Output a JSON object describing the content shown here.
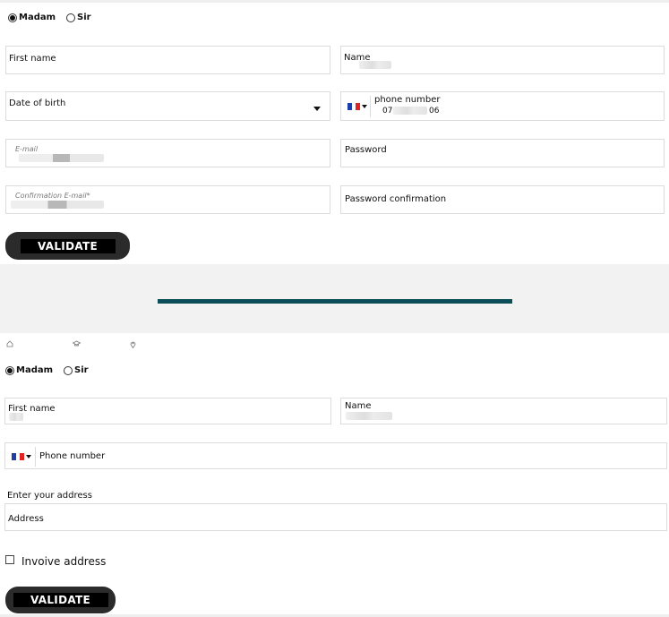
{
  "form1": {
    "gender": {
      "madam": "Madam",
      "sir": "Sir",
      "selected": "madam"
    },
    "first_name_label": "First name",
    "name_label": "Name",
    "dob_label": "Date of birth",
    "phone_label": "phone number",
    "phone_prefix": "07",
    "phone_suffix": "06",
    "email_label": "E-mail",
    "password_label": "Password",
    "confirm_email_label": "Confirmation E-mail*",
    "password_confirm_label": "Password confirmation",
    "validate_label": "VALIDATE"
  },
  "divider": {
    "color": "#0c4e57",
    "band_color": "#f2f2f2"
  },
  "steps": {
    "icons": [
      "home-icon",
      "graduation-cap-icon",
      "location-pin-icon"
    ]
  },
  "form2": {
    "gender": {
      "madam": "Madam",
      "sir": "Sir",
      "selected": "madam"
    },
    "first_name_label": "First name",
    "name_label": "Name",
    "phone_label": "Phone number",
    "address_heading": "Enter your address",
    "address_label": "Address",
    "invoice_label": "Invoive address",
    "validate_label": "VALIDATE"
  },
  "colors": {
    "button_bg": "#2b2b2b",
    "button_inner": "#000000",
    "border": "#dcdcdc"
  }
}
